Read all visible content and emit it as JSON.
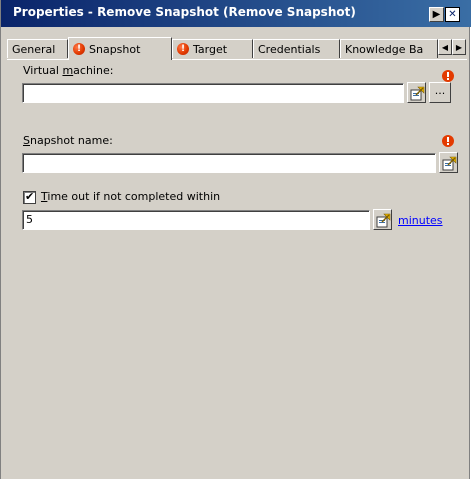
{
  "window": {
    "title": "Properties - Remove Snapshot (Remove Snapshot)",
    "pin_glyph": "▶",
    "close_glyph": "✕"
  },
  "tabs": [
    {
      "label": "General",
      "has_error": false,
      "active": false
    },
    {
      "label": "Snapshot",
      "has_error": true,
      "active": true
    },
    {
      "label": "Target",
      "has_error": true,
      "active": false
    },
    {
      "label": "Credentials",
      "has_error": false,
      "active": false
    },
    {
      "label": "Knowledge Ba",
      "has_error": false,
      "active": false
    }
  ],
  "tab_scroll": {
    "left": "◀",
    "right": "▶"
  },
  "error_glyph": "!",
  "form": {
    "virtual_machine": {
      "label_pre": "Virtual ",
      "label_accel": "m",
      "label_post": "achine:",
      "value": "",
      "browse_label": "..."
    },
    "snapshot_name": {
      "label_pre": "",
      "label_accel": "S",
      "label_post": "napshot name:",
      "value": ""
    },
    "timeout": {
      "checked": true,
      "check_glyph": "✔",
      "label_pre": "",
      "label_accel": "T",
      "label_post": "ime out if not completed within",
      "value": "5",
      "unit_link": "minutes"
    }
  },
  "colors": {
    "title_start": "#0a246a",
    "title_end": "#3a6ea5",
    "dialog_bg": "#d4d0c8",
    "error_red": "#e33a00",
    "link_blue": "#0000ff"
  },
  "icons": {
    "pick": "published-data-icon",
    "error": "error-exclamation-icon"
  }
}
